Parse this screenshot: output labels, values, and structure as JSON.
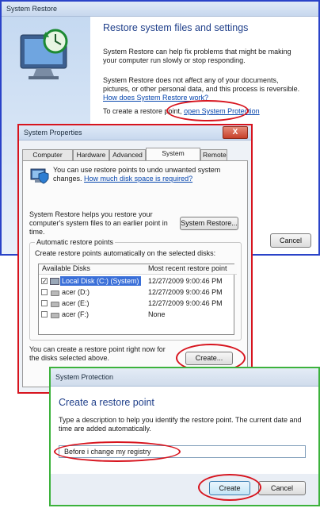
{
  "sr_window": {
    "title": "System Restore",
    "heading": "Restore system files and settings",
    "para1": "System Restore can help fix problems that might be making your computer run slowly or stop responding.",
    "para2_text": "System Restore does not affect any of your documents, pictures, or other personal data, and this process is reversible.",
    "para2_link": "How does System Restore work?",
    "para3_text": "To create a restore point,",
    "para3_link": "open System Protection",
    "cancel_label": "Cancel"
  },
  "sp_window": {
    "title": "System Properties",
    "close_label": "X",
    "tabs": [
      "Computer Name",
      "Hardware",
      "Advanced",
      "System Protection",
      "Remote"
    ],
    "info_text": "You can use restore points to undo unwanted system changes.",
    "info_link": "How much disk space is required?",
    "restore_desc": "System Restore helps you restore your computer's system files to an earlier point in time.",
    "restore_button": "System Restore...",
    "group_label": "Automatic restore points",
    "group_desc": "Create restore points automatically on the selected disks:",
    "table_headers": [
      "Available Disks",
      "Most recent restore point"
    ],
    "disks": [
      {
        "name": "Local Disk (C:) (System)",
        "point": "12/27/2009 9:00:46 PM",
        "checked": true
      },
      {
        "name": "acer (D:)",
        "point": "12/27/2009 9:00:46 PM",
        "checked": false
      },
      {
        "name": "acer (E:)",
        "point": "12/27/2009 9:00:46 PM",
        "checked": false
      },
      {
        "name": "acer (F:)",
        "point": "None",
        "checked": false
      }
    ],
    "create_desc": "You can create a restore point right now for the disks selected above.",
    "create_button": "Create..."
  },
  "prot_window": {
    "title": "System Protection",
    "heading": "Create a restore point",
    "description": "Type a description to help you identify the restore point. The current date and time are added automatically.",
    "input_value": "Before i change my registry",
    "create_button": "Create",
    "cancel_button": "Cancel"
  },
  "colors": {
    "highlight_ring": "#d7141e",
    "sp_border": "#d7141e",
    "prot_border": "#3cb23c",
    "sr_border": "#2a43c8"
  }
}
